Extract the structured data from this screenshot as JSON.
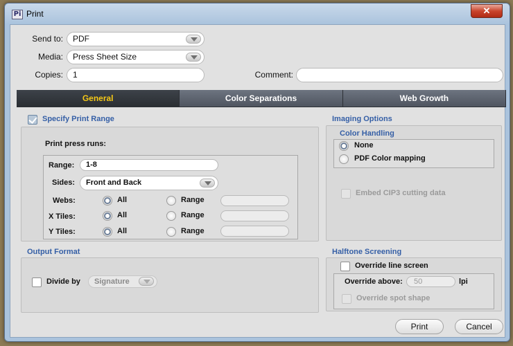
{
  "window": {
    "title": "Print",
    "app_icon_text": "Pi",
    "close_symbol": "✕"
  },
  "general_fields": {
    "send_to_label": "Send to:",
    "send_to_value": "PDF",
    "media_label": "Media:",
    "media_value": "Press Sheet Size",
    "copies_label": "Copies:",
    "copies_value": "1",
    "comment_label": "Comment:",
    "comment_value": ""
  },
  "tabs": [
    {
      "label": "General",
      "active": true
    },
    {
      "label": "Color Separations",
      "active": false
    },
    {
      "label": "Web Growth",
      "active": false
    }
  ],
  "print_range": {
    "checkbox_label": "Specify Print Range",
    "checked": true,
    "press_runs_label": "Print press runs:",
    "range_label": "Range:",
    "range_value": "1-8",
    "sides_label": "Sides:",
    "sides_value": "Front and Back",
    "webs_label": "Webs:",
    "xtiles_label": "X Tiles:",
    "ytiles_label": "Y Tiles:",
    "all_label": "All",
    "range_option_label": "Range"
  },
  "imaging_options": {
    "title": "Imaging Options",
    "color_handling_title": "Color Handling",
    "none_label": "None",
    "pdf_color_label": "PDF Color mapping",
    "embed_cip3_label": "Embed CIP3 cutting data"
  },
  "output_format": {
    "title": "Output Format",
    "divide_by_label": "Divide by",
    "divide_by_value": "Signature"
  },
  "halftone": {
    "title": "Halftone Screening",
    "override_line_screen_label": "Override line screen",
    "override_above_label": "Override above:",
    "override_above_value": "50",
    "lpi_label": "lpi",
    "override_spot_label": "Override spot shape"
  },
  "buttons": {
    "print": "Print",
    "cancel": "Cancel"
  },
  "colors": {
    "accent_tab_text": "#f5c816",
    "group_title": "#355fa6",
    "close_button": "#c9442c"
  }
}
